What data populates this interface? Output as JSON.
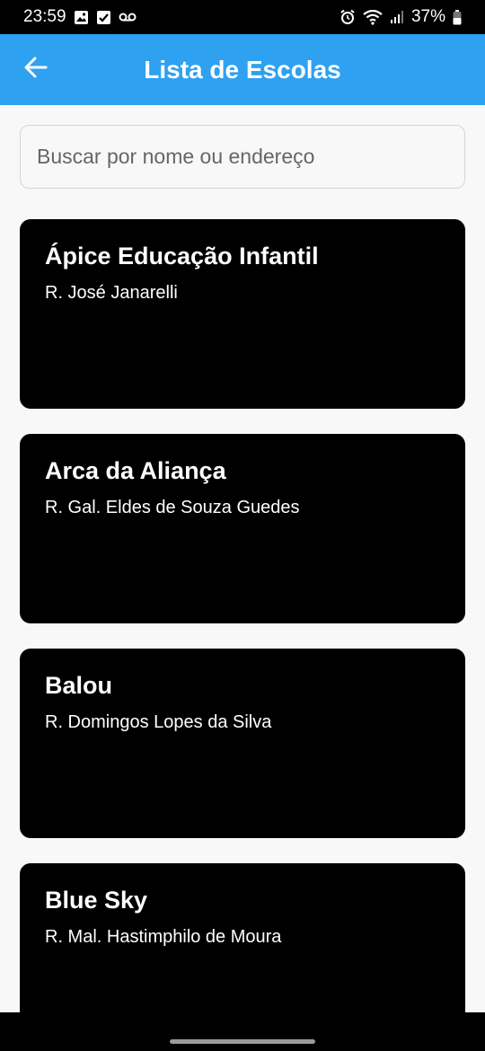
{
  "status_bar": {
    "time": "23:59",
    "battery": "37%",
    "icons_left": [
      "image-icon",
      "check-box-icon",
      "voicemail-icon"
    ],
    "icons_right": [
      "alarm-icon",
      "wifi-icon",
      "signal-icon",
      "battery-icon"
    ]
  },
  "app_bar": {
    "title": "Lista de Escolas",
    "back_icon": "arrow-back-icon",
    "color": "#2ea1f0"
  },
  "search": {
    "placeholder": "Buscar por nome ou endereço",
    "value": ""
  },
  "schools": [
    {
      "name": "Ápice Educação Infantil",
      "address": "R. José Janarelli"
    },
    {
      "name": "Arca da Aliança",
      "address": "R. Gal. Eldes de Souza Guedes"
    },
    {
      "name": "Balou",
      "address": "R. Domingos Lopes da Silva"
    },
    {
      "name": "Blue Sky",
      "address": "R. Mal. Hastimphilo de Moura"
    }
  ]
}
